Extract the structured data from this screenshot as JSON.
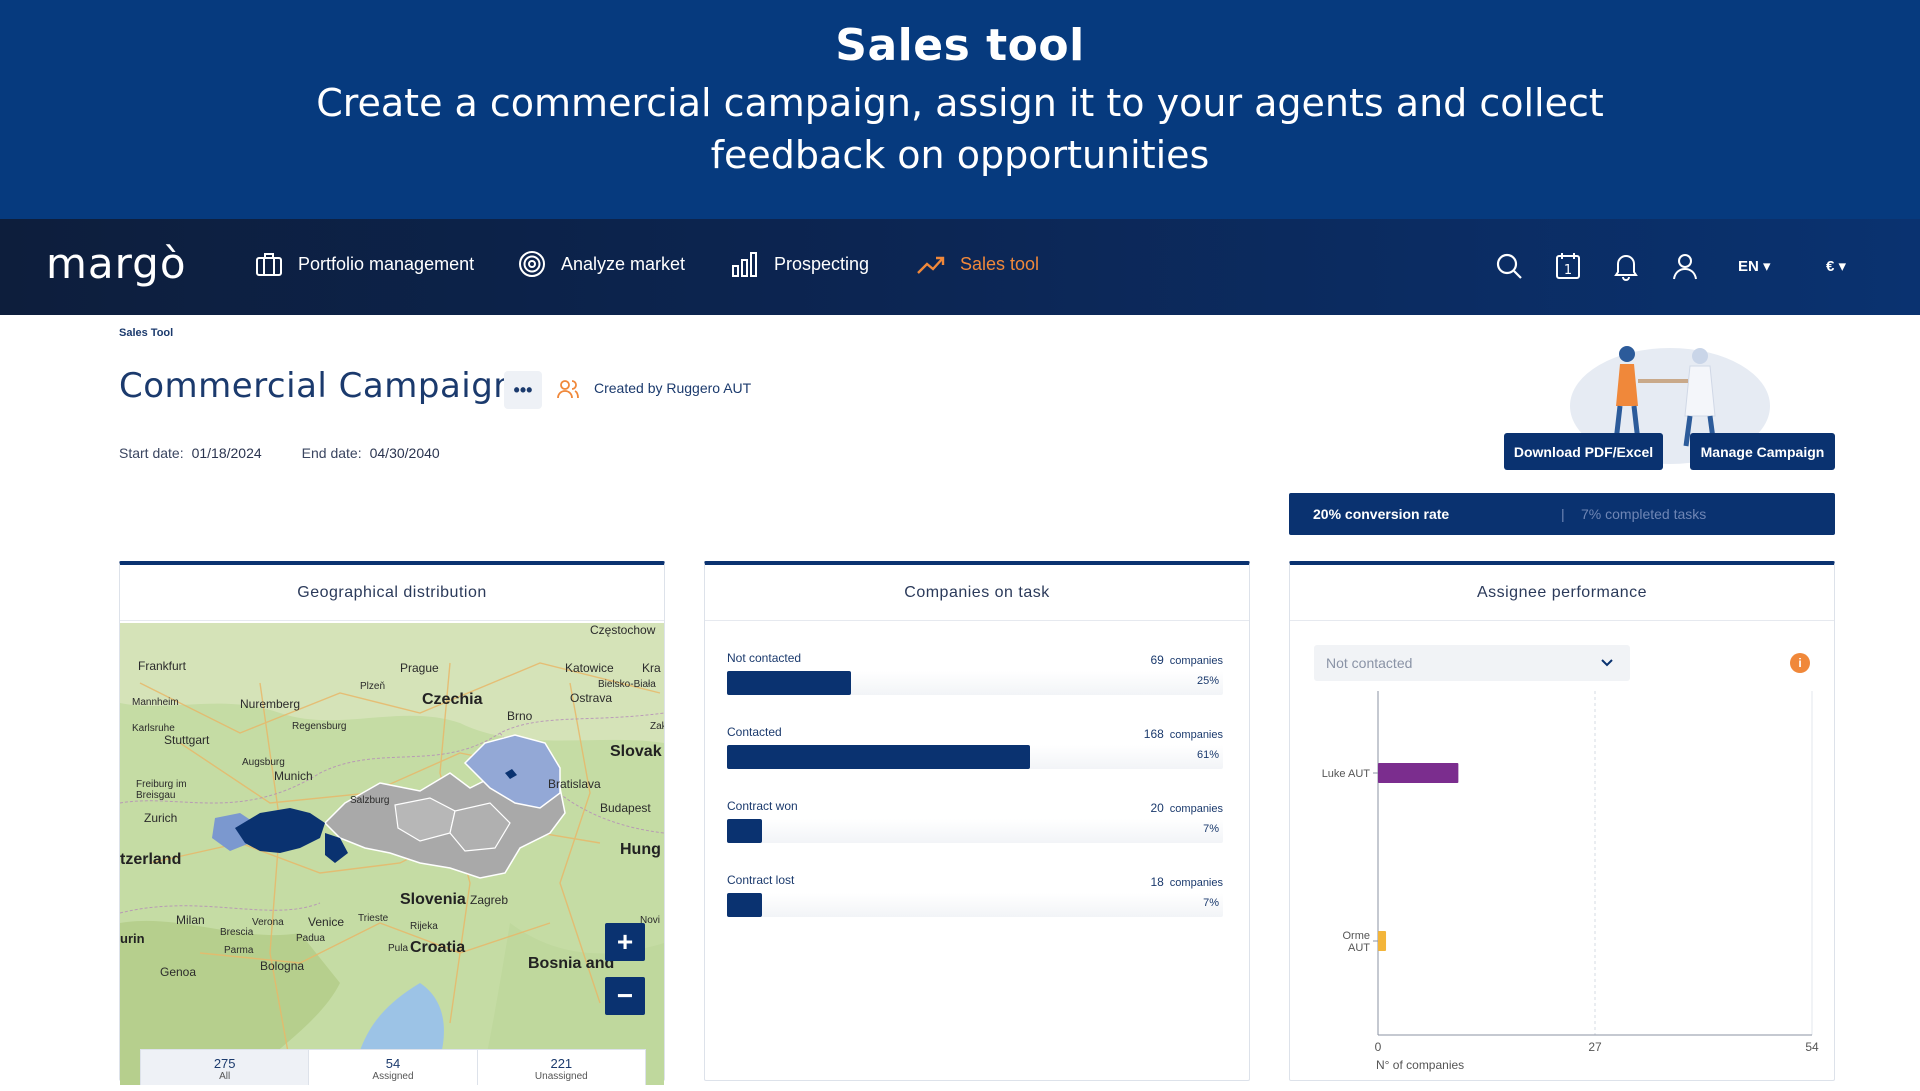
{
  "banner": {
    "title": "Sales tool",
    "subtitle_line1": "Create a commercial campaign, assign it to your agents and collect",
    "subtitle_line2": "feedback on opportunities"
  },
  "navbar": {
    "logo": "margò",
    "items": [
      {
        "label": "Portfolio management",
        "icon": "briefcase-icon"
      },
      {
        "label": "Analyze market",
        "icon": "target-icon"
      },
      {
        "label": "Prospecting",
        "icon": "bar-chart-icon"
      },
      {
        "label": "Sales tool",
        "icon": "trend-up-icon",
        "active": true
      }
    ],
    "language": "EN ▾",
    "currency": "€ ▾"
  },
  "page": {
    "breadcrumb": "Sales Tool",
    "title": "Commercial Campaign",
    "more": "•••",
    "created_by": "Created by Ruggero AUT",
    "start_label": "Start date:",
    "start_value": "01/18/2024",
    "end_label": "End date:",
    "end_value": "04/30/2040",
    "download_button": "Download PDF/Excel",
    "manage_button": "Manage Campaign",
    "conversion_rate": "20% conversion rate",
    "separator": "|",
    "completed_tasks": "7% completed tasks"
  },
  "geo": {
    "title": "Geographical distribution",
    "zoom_in": "+",
    "zoom_out": "−",
    "labels": [
      "Częstochow",
      "Frankfurt",
      "Prague",
      "Katowice",
      "Kra",
      "Bielsko-Biała",
      "Mannheim",
      "Nuremberg",
      "Czechia",
      "Plzeň",
      "Ostrava",
      "Karlsruhe",
      "Stuttgart",
      "Regensburg",
      "Brno",
      "Slovak",
      "Augsburg",
      "Munich",
      "Freiburg im Breisgau",
      "Salzburg",
      "Bratislava",
      "Zurich",
      "Budapest",
      "tzerland",
      "Hung",
      "Slovenia",
      "Zagreb",
      "Milan",
      "Verona",
      "Venice",
      "Trieste",
      "Rijeka",
      "Brescia",
      "Padua",
      "Novi",
      "urin",
      "Parma",
      "Pula",
      "Croatia",
      "Genoa",
      "Bologna",
      "Bosnia and",
      "Zak"
    ],
    "tabs": [
      {
        "count": "275",
        "label": "All"
      },
      {
        "count": "54",
        "label": "Assigned"
      },
      {
        "count": "221",
        "label": "Unassigned"
      }
    ]
  },
  "tasks": {
    "title": "Companies on task",
    "unit": "companies",
    "rows": [
      {
        "label": "Not contacted",
        "count": "69",
        "pct": "25%",
        "fraction": 0.25
      },
      {
        "label": "Contacted",
        "count": "168",
        "pct": "61%",
        "fraction": 0.61
      },
      {
        "label": "Contract won",
        "count": "20",
        "pct": "7%",
        "fraction": 0.07
      },
      {
        "label": "Contract lost",
        "count": "18",
        "pct": "7%",
        "fraction": 0.07
      }
    ]
  },
  "assignee": {
    "title": "Assignee performance",
    "select_value": "Not contacted",
    "info": "i"
  },
  "chart_data": {
    "type": "bar",
    "orientation": "horizontal",
    "categories": [
      "Luke AUT",
      "Orme AUT"
    ],
    "values": [
      10,
      1
    ],
    "xlabel": "N° of companies",
    "xticks": [
      "0",
      "27",
      "54"
    ],
    "xlim": [
      0,
      54
    ],
    "colors": [
      "#7b2d8e",
      "#f3b53a"
    ],
    "grid": "vertical dashed at 27"
  },
  "colors": {
    "primary": "#0a3270",
    "accent": "#f0883a",
    "banner": "#063a7e"
  }
}
